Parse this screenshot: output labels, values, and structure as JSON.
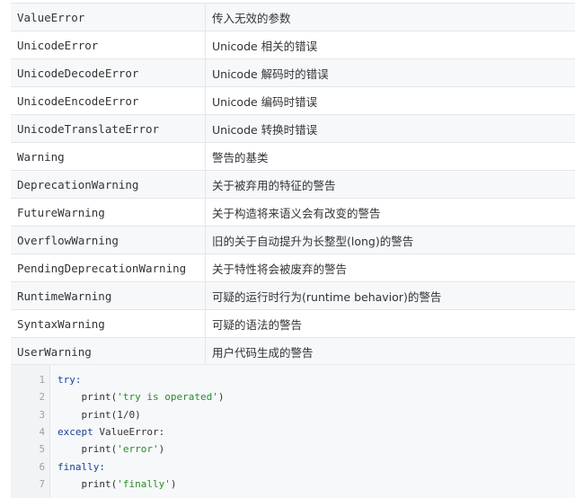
{
  "table": {
    "rows": [
      {
        "name": "ValueError",
        "desc": "传入无效的参数"
      },
      {
        "name": "UnicodeError",
        "desc": "Unicode 相关的错误"
      },
      {
        "name": "UnicodeDecodeError",
        "desc": "Unicode 解码时的错误"
      },
      {
        "name": "UnicodeEncodeError",
        "desc": "Unicode 编码时错误"
      },
      {
        "name": "UnicodeTranslateError",
        "desc": "Unicode 转换时错误"
      },
      {
        "name": "Warning",
        "desc": "警告的基类"
      },
      {
        "name": "DeprecationWarning",
        "desc": "关于被弃用的特征的警告"
      },
      {
        "name": "FutureWarning",
        "desc": "关于构造将来语义会有改变的警告"
      },
      {
        "name": "OverflowWarning",
        "desc": "旧的关于自动提升为长整型(long)的警告"
      },
      {
        "name": "PendingDeprecationWarning",
        "desc": "关于特性将会被废弃的警告"
      },
      {
        "name": "RuntimeWarning",
        "desc": "可疑的运行时行为(runtime behavior)的警告"
      },
      {
        "name": "SyntaxWarning",
        "desc": "可疑的语法的警告"
      },
      {
        "name": "UserWarning",
        "desc": "用户代码生成的警告"
      }
    ]
  },
  "code": {
    "lines": [
      {
        "num": "1",
        "indent": "",
        "kw": "try:",
        "pre": "",
        "str": "",
        "post": ""
      },
      {
        "num": "2",
        "indent": "    ",
        "kw": "",
        "pre": "print(",
        "str": "'try is operated'",
        "post": ")"
      },
      {
        "num": "3",
        "indent": "    ",
        "kw": "",
        "pre": "print(1/0)",
        "str": "",
        "post": ""
      },
      {
        "num": "4",
        "indent": "",
        "kw": "except",
        "pre": " ValueError:",
        "str": "",
        "post": ""
      },
      {
        "num": "5",
        "indent": "    ",
        "kw": "",
        "pre": "print(",
        "str": "'error'",
        "post": ")"
      },
      {
        "num": "6",
        "indent": "",
        "kw": "finally:",
        "pre": "",
        "str": "",
        "post": ""
      },
      {
        "num": "7",
        "indent": "    ",
        "kw": "",
        "pre": "print(",
        "str": "'finally'",
        "post": ")"
      }
    ]
  }
}
